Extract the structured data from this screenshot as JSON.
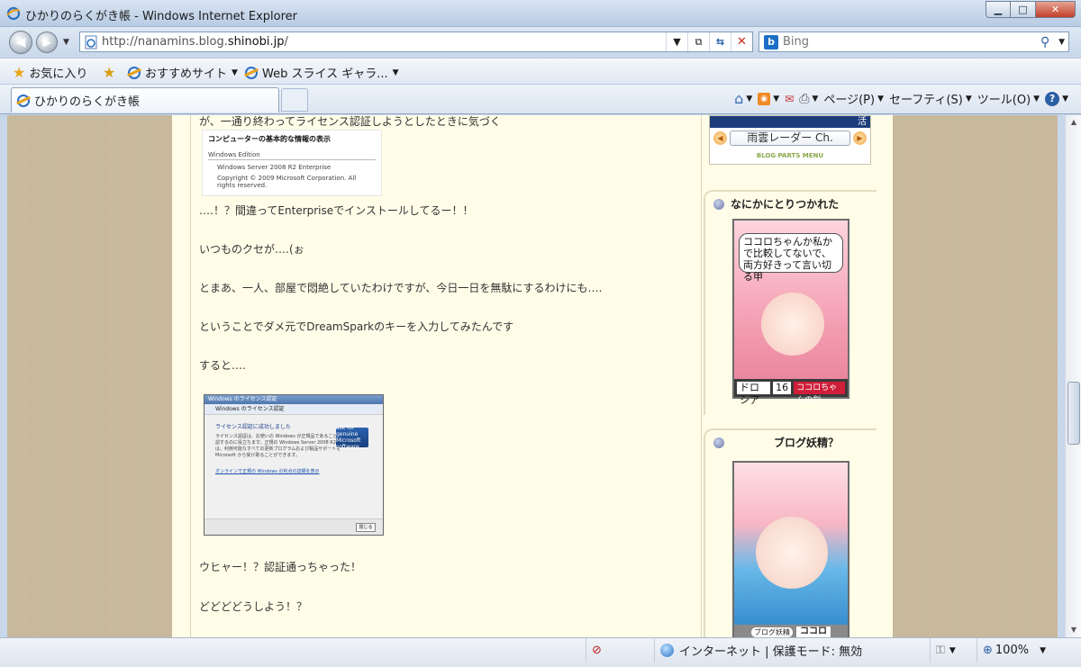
{
  "window": {
    "title": "ひかりのらくがき帳 - Windows Internet Explorer",
    "min": "▁",
    "max": "□",
    "close": "✕"
  },
  "nav": {
    "url_prefix": "http://nanamins.blog.",
    "url_domain": "shinobi.jp",
    "url_suffix": "/",
    "search_placeholder": "Bing",
    "search_engine_glyph": "b"
  },
  "favorites": {
    "label": "お気に入り",
    "items": [
      {
        "label": "おすすめサイト"
      },
      {
        "label": "Web スライス ギャラ..."
      }
    ]
  },
  "tabs": [
    {
      "label": "ひかりのらくがき帳"
    }
  ],
  "commands": [
    {
      "label": "ページ(P)",
      "name": "page-menu"
    },
    {
      "label": "セーフティ(S)",
      "name": "safety-menu"
    },
    {
      "label": "ツール(O)",
      "name": "tools-menu"
    }
  ],
  "post": {
    "lines": [
      "が、一通り終わってライセンス認証しようとしたときに気づく",
      "‥‥！？間違ってEnterpriseでインストールしてるー！！",
      "いつものクセが‥‥(ぉ",
      "とまあ、一人、部屋で悶絶していたわけですが、今日一日を無駄にするわけにも‥‥",
      "ということでダメ元でDreamSparkのキーを入力してみたんです",
      "すると‥‥",
      "ウヒャー！？認証通っちゃった！",
      "どどどどうしよう！？"
    ],
    "shot1": {
      "heading": "コンピューターの基本的な情報の表示",
      "section": "Windows Edition",
      "edition": "Windows Server 2008 R2 Enterprise",
      "copyright": "Copyright © 2009 Microsoft Corporation.  All rights reserved."
    },
    "shot2": {
      "titlebar": "Windows のライセンス認証",
      "header": "Windows のライセンス認証",
      "title": "ライセンス認証に成功しました",
      "body": "ライセンス認証は、お使いの Windows が正規品であることを確認するのに役立ちます。正規の Windows Server 2008 R2 では、利用可能なすべての更新プログラムおよび製品サポートを Microsoft から受け取ることができます。",
      "genuine": "ask for genuine Microsoft software",
      "link": "オンラインで正規の Windows の利点の詳細を表示",
      "ok": "閉じる"
    }
  },
  "sidebar": {
    "top_widget": {
      "header": "活",
      "radar": "雨雲レーダー Ch.",
      "menu": "BLOG PARTS MENU"
    },
    "box1": {
      "title": "なにかにとりつかれた",
      "bubble": "ココロちゃんか私かで比較してないで、両方好きって言い切る甲",
      "name": "ドロシア",
      "level": "16",
      "tag": "ココロちゃんの剣"
    },
    "box2": {
      "title": "ブログ妖精？",
      "label": "ブログ妖精",
      "name": "ココロ"
    }
  },
  "status": {
    "zone": "インターネット | 保護モード: 無効",
    "zoom": "100%"
  }
}
